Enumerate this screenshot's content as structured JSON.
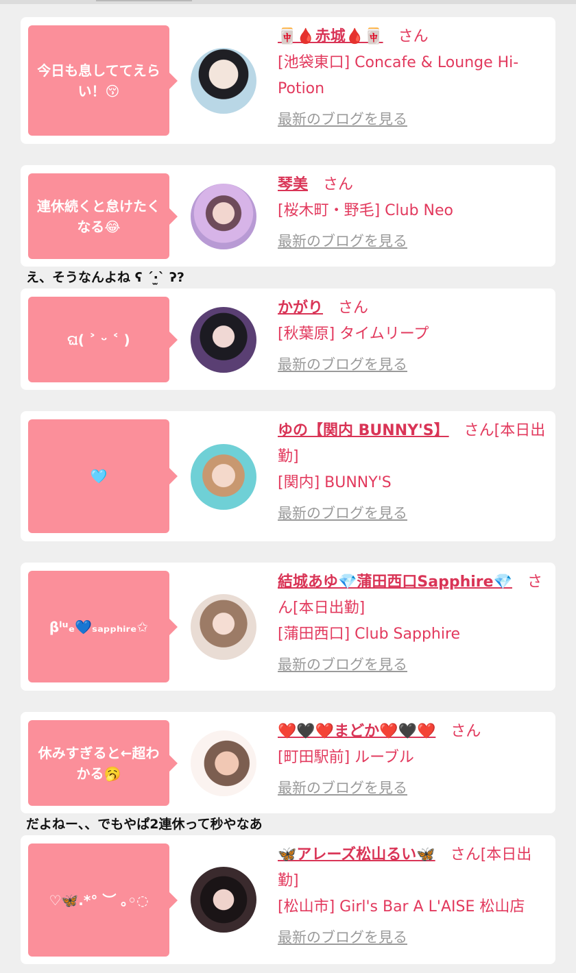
{
  "cards": [
    {
      "bubble": "今日も息しててえらい！😚",
      "name": "🀄🩸赤城🩸🀄",
      "san": "さん",
      "store": "[池袋東口] Concafe & Lounge Hi-Potion",
      "blog": "最新のブログを見る"
    },
    {
      "bubble": "連休続くと怠けたくなる😂",
      "name": "琴美",
      "san": "さん",
      "store": "[桜木町・野毛] Club Neo",
      "blog": "最新のブログを見る"
    },
    {
      "bubble": "ଘ( ˃ ᵕ ˂ )",
      "name": "かがり",
      "san": "さん",
      "store": "[秋葉原] タイムリープ",
      "blog": "最新のブログを見る"
    },
    {
      "bubble": "🩵",
      "name": "ゆの【関内 BUNNY'S】",
      "san": "さん[本日出勤]",
      "store": "[関内] BUNNY'S",
      "blog": "最新のブログを見る"
    },
    {
      "bubble": "βˡᵘₑ💙ₛₐₚₚₕᵢᵣₑ✩",
      "name": "結城あゆ💎蒲田西口Sapphire💎",
      "san": "さん[本日出勤]",
      "store": "[蒲田西口] Club Sapphire",
      "blog": "最新のブログを見る"
    },
    {
      "bubble": "休みすぎると←超わかる🥱",
      "name": "❤️🖤❤️まどか❤️🖤❤️",
      "san": "さん",
      "store": "[町田駅前] ルーブル",
      "blog": "最新のブログを見る"
    },
    {
      "bubble": "♡🦋.*° ︶ ｡◦◌",
      "name": "🦋アレーズ松山るい🦋",
      "san": "さん[本日出勤]",
      "store": "[松山市] Girl's Bar A L'AISE 松山店",
      "blog": "最新のブログを見る"
    }
  ],
  "comments": [
    "え、そうなんよね ʕ ˊ·̫ˋ ʔ?",
    "だよねー、、でもやぱ2連休って秒やなあ"
  ],
  "colors": {
    "bubble": "#fb8f9a",
    "name": "#d93456",
    "link": "#9a9a9a",
    "background": "#efefef"
  }
}
